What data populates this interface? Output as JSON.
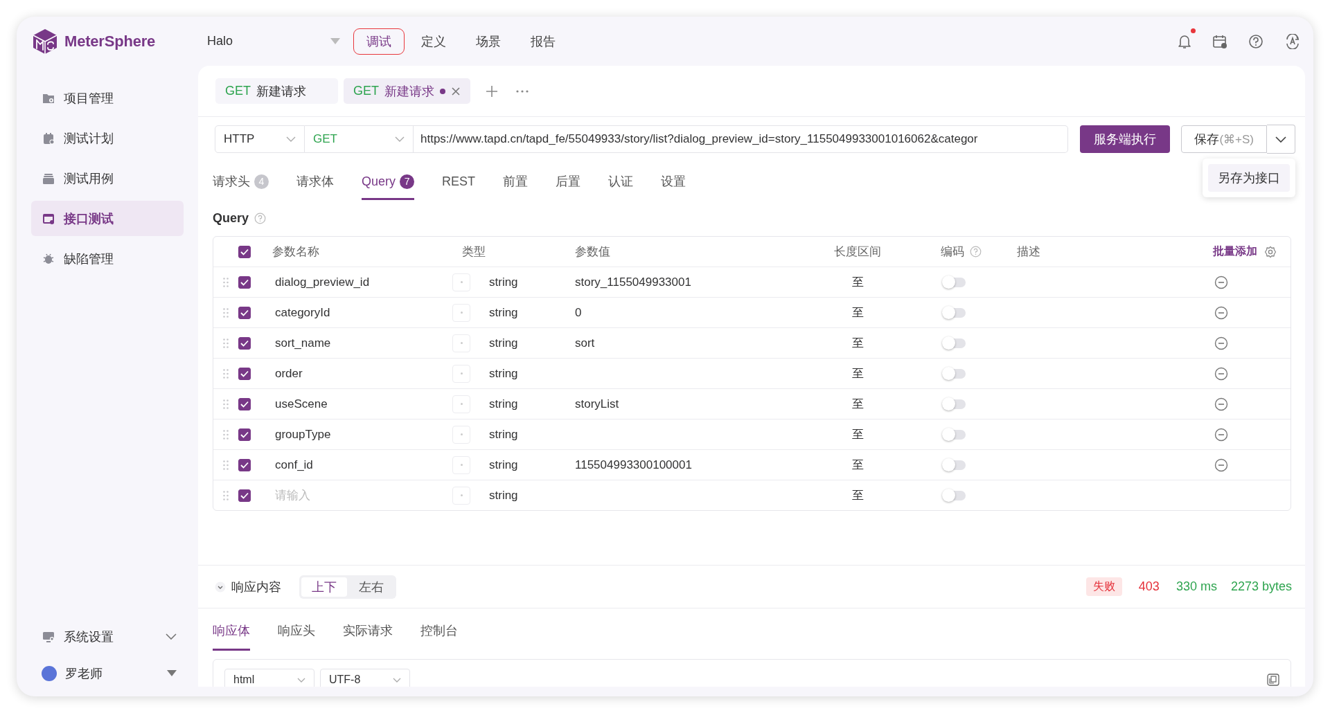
{
  "app": {
    "name": "MeterSphere"
  },
  "header": {
    "project": "Halo",
    "nav": [
      {
        "label": "调试",
        "selected": true
      },
      {
        "label": "定义",
        "selected": false
      },
      {
        "label": "场景",
        "selected": false
      },
      {
        "label": "报告",
        "selected": false
      }
    ],
    "notifications": {
      "unread": true
    }
  },
  "sidebar": {
    "items": [
      {
        "label": "项目管理",
        "selected": false
      },
      {
        "label": "测试计划",
        "selected": false
      },
      {
        "label": "测试用例",
        "selected": false
      },
      {
        "label": "接口测试",
        "selected": true
      },
      {
        "label": "缺陷管理",
        "selected": false
      }
    ],
    "settings": {
      "label": "系统设置"
    },
    "user": {
      "name": "罗老师"
    }
  },
  "request_tabs": [
    {
      "method": "GET",
      "title": "新建请求",
      "selected": false,
      "modified": false
    },
    {
      "method": "GET",
      "title": "新建请求",
      "selected": true,
      "modified": true
    }
  ],
  "request": {
    "protocol": "HTTP",
    "method": "GET",
    "url": "https://www.tapd.cn/tapd_fe/55049933/story/list?dialog_preview_id=story_1155049933001016062&categor",
    "run_label": "服务端执行",
    "save_label": "保存",
    "save_shortcut": "(⌘+S)",
    "save_menu": [
      {
        "label": "另存为接口"
      }
    ]
  },
  "param_tabs": [
    {
      "label": "请求头",
      "count": "4",
      "selected": false
    },
    {
      "label": "请求体",
      "selected": false
    },
    {
      "label": "Query",
      "count": "7",
      "selected": true
    },
    {
      "label": "REST",
      "selected": false
    },
    {
      "label": "前置",
      "selected": false
    },
    {
      "label": "后置",
      "selected": false
    },
    {
      "label": "认证",
      "selected": false
    },
    {
      "label": "设置",
      "selected": false
    }
  ],
  "query": {
    "title": "Query",
    "all_checked": true,
    "columns": [
      "参数名称",
      "类型",
      "参数值",
      "长度区间",
      "编码",
      "描述"
    ],
    "batch_add": "批量添加",
    "rows": [
      {
        "checked": true,
        "name": "dialog_preview_id",
        "type": "string",
        "value": "story_1155049933001",
        "range": "至",
        "encode": false,
        "removable": true
      },
      {
        "checked": true,
        "name": "categoryId",
        "type": "string",
        "value": "0",
        "range": "至",
        "encode": false,
        "removable": true
      },
      {
        "checked": true,
        "name": "sort_name",
        "type": "string",
        "value": "sort",
        "range": "至",
        "encode": false,
        "removable": true
      },
      {
        "checked": true,
        "name": "order",
        "type": "string",
        "range": "至",
        "encode": false,
        "removable": true
      },
      {
        "checked": true,
        "name": "useScene",
        "type": "string",
        "value": "storyList",
        "range": "至",
        "encode": false,
        "removable": true
      },
      {
        "checked": true,
        "name": "groupType",
        "type": "string",
        "range": "至",
        "encode": false,
        "removable": true
      },
      {
        "checked": true,
        "name": "conf_id",
        "type": "string",
        "value": "115504993300100001",
        "range": "至",
        "encode": false,
        "removable": true
      },
      {
        "checked": true,
        "placeholder": "请输入",
        "type": "string",
        "range": "至",
        "encode": false,
        "removable": false
      }
    ]
  },
  "response": {
    "title": "响应内容",
    "layouts": [
      {
        "label": "上下",
        "selected": true
      },
      {
        "label": "左右",
        "selected": false
      }
    ],
    "result": "失败",
    "status_code": "403",
    "duration": "330 ms",
    "size": "2273 bytes",
    "tabs": [
      {
        "label": "响应体",
        "selected": true
      },
      {
        "label": "响应头",
        "selected": false
      },
      {
        "label": "实际请求",
        "selected": false
      },
      {
        "label": "控制台",
        "selected": false
      }
    ],
    "format": "html",
    "encoding": "UTF-8"
  }
}
